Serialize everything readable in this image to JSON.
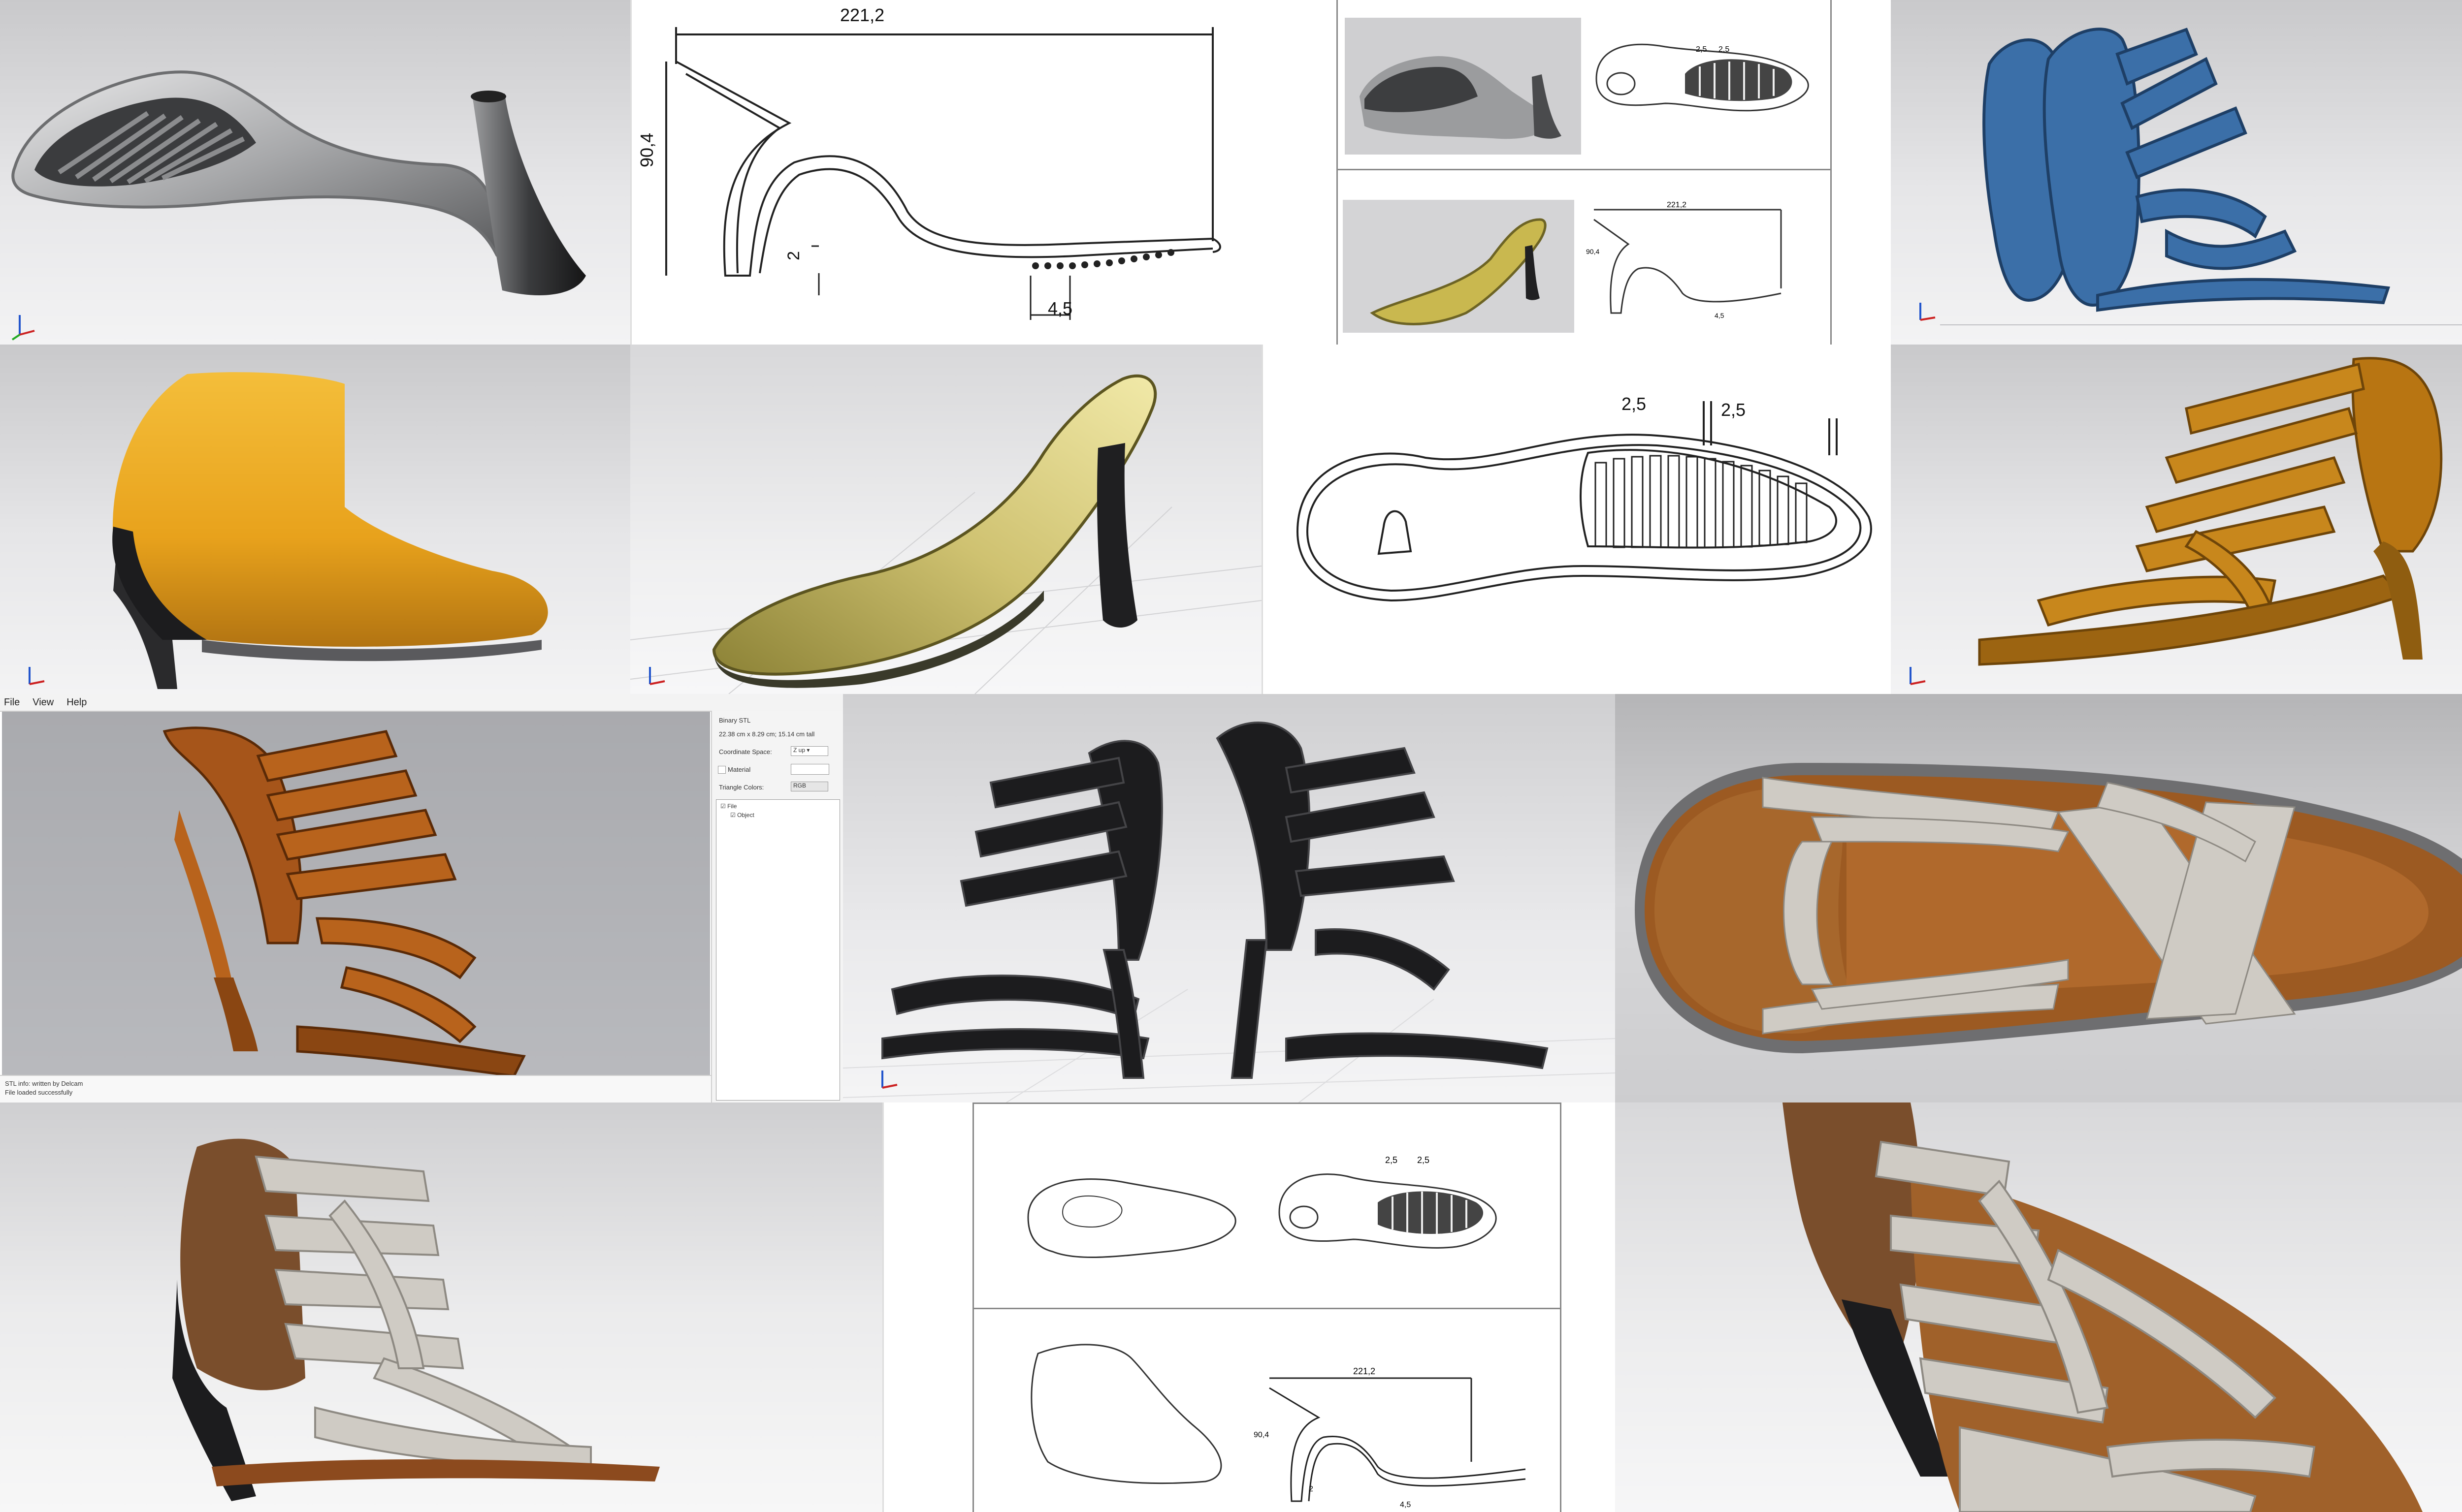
{
  "drawing1": {
    "length": "221,2",
    "height": "90,4",
    "heel_tip": "2",
    "sole_gap": "4,5"
  },
  "drawing2": {
    "offset_a": "2,5",
    "offset_b": "2,5"
  },
  "sheet1": {
    "thumb_top": {
      "offset_a": "2,5",
      "offset_b": "2,5"
    },
    "thumb_bottom": {
      "length": "221,2",
      "height": "90,4",
      "sole_gap": "4,5"
    }
  },
  "sheet2": {
    "offset_a": "2,5",
    "offset_b": "2,5",
    "length": "221,2",
    "height": "90,4",
    "heel_tip": "2",
    "sole_gap": "4,5"
  },
  "viewer": {
    "menu": [
      "File",
      "View",
      "Help"
    ],
    "file_type": "Binary STL",
    "dimensions": "22.38 cm x 8.29 cm; 15.14 cm tall",
    "coord_label": "Coordinate Space:",
    "coord_value": "Z up",
    "material_label": "Material",
    "triangle_label": "Triangle Colors:",
    "triangle_value": "RGB",
    "tree_root": "File",
    "tree_child": "Object",
    "status_line1": "STL info: written by Delcam",
    "status_line2": "File loaded successfully"
  },
  "colors": {
    "gold": "#e8a21c",
    "leather_tan": "#b8631c",
    "blue": "#3b6fa8",
    "black": "#1c1c1e",
    "grey_strap": "#cfcbc4",
    "sole_brown": "#8c4a1e",
    "lemon_gold": "#cfc271"
  }
}
